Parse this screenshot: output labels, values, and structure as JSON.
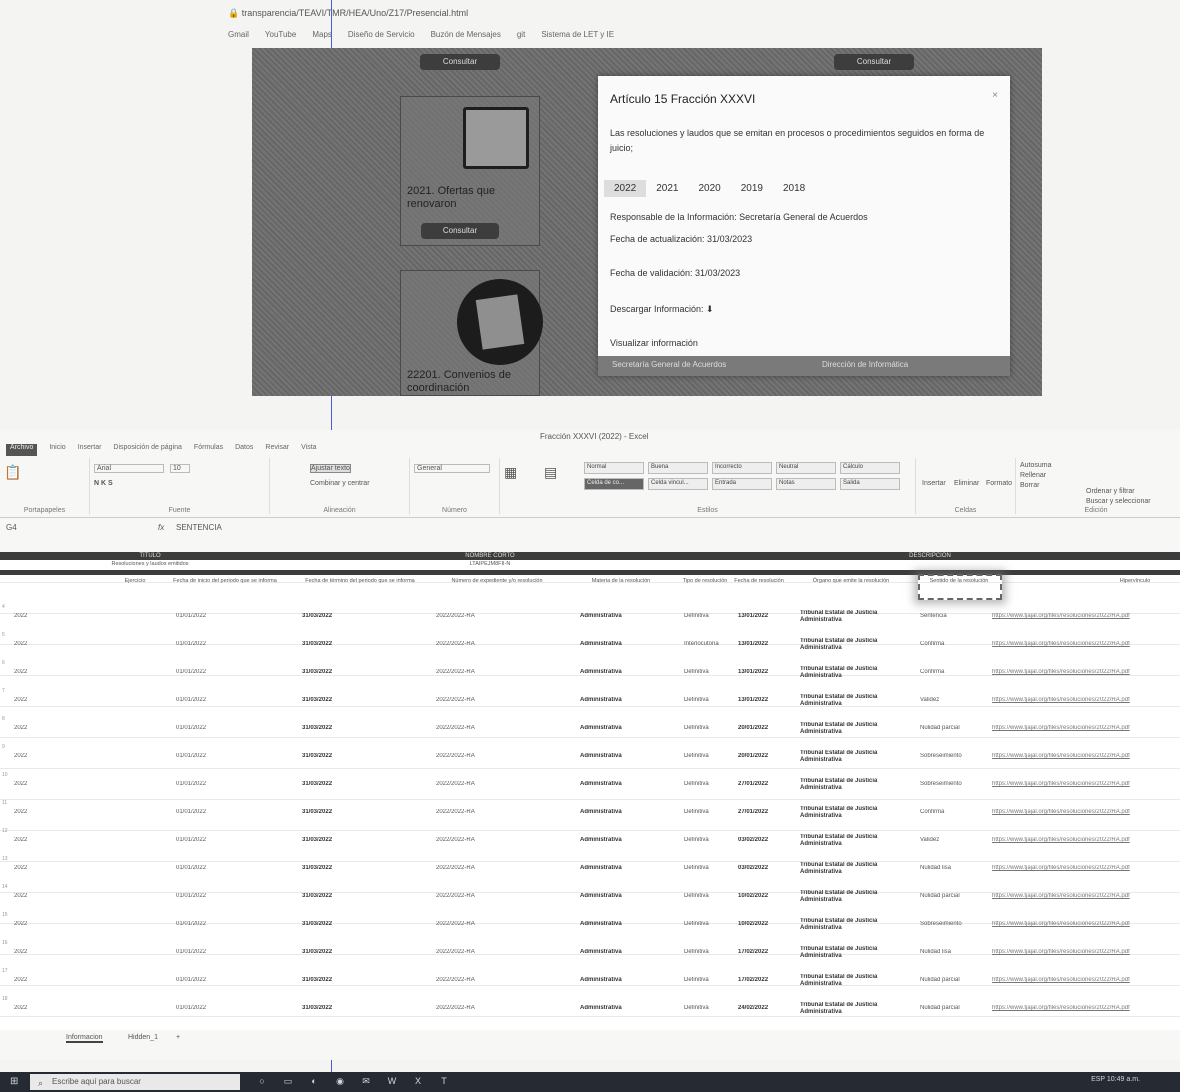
{
  "browser": {
    "url": "transparencia/TEAVI/TMR/HEA/Uno/Z17/Presencial.html",
    "bookmarks": [
      "Gmail",
      "YouTube",
      "Maps",
      "Diseño de Servicio",
      "Buzón de Mensajes",
      "git",
      "Sistema de LET y IE"
    ]
  },
  "web": {
    "tiles": [
      {
        "title": "2021. Ofertas que renovaron",
        "button": "Consultar"
      },
      {
        "title": "22201. Convenios de coordinación",
        "button": ""
      }
    ],
    "top_buttons": [
      "Consultar",
      "Consultar"
    ],
    "modal": {
      "title": "Artículo 15 Fracción XXXVI",
      "close": "×",
      "description": "Las resoluciones y laudos que se emitan en procesos o procedimientos seguidos en forma de juicio;",
      "years": [
        "2022",
        "2021",
        "2020",
        "2019",
        "2018"
      ],
      "responsible": "Responsable de la Información: Secretaría General de Acuerdos",
      "updated": "Fecha de actualización: 31/03/2023",
      "validated": "Fecha de validación: 31/03/2023",
      "download": "Descargar Información: ⬇",
      "view": "Visualizar información",
      "footer_left": "Secretaría General de Acuerdos",
      "footer_right": "Dirección de Informática"
    }
  },
  "excel": {
    "title": "Fracción XXXVI (2022) - Excel",
    "tabs": [
      "Archivo",
      "Inicio",
      "Insertar",
      "Disposición de página",
      "Fórmulas",
      "Datos",
      "Revisar",
      "Vista"
    ],
    "ribbon": {
      "font": "Arial",
      "size": "10",
      "wrap": "Ajustar texto",
      "merge": "Combinar y centrar",
      "number_format": "General",
      "styles": [
        "Normal",
        "Buena",
        "Incorrecto",
        "Neutral",
        "Cálculo",
        "Celda de co...",
        "Celda vincul...",
        "Entrada",
        "Notas",
        "Salida"
      ],
      "cells": [
        "Insertar",
        "Eliminar",
        "Formato"
      ],
      "edit": [
        "Autosuma",
        "Rellenar",
        "Borrar",
        "Ordenar y filtrar",
        "Buscar y seleccionar"
      ],
      "group_labels": [
        "Portapapeles",
        "Fuente",
        "Alineación",
        "Número",
        "Estilos",
        "Celdas",
        "Edición"
      ]
    },
    "name_box": "G4",
    "formula": "SENTENCIA",
    "headers": {
      "band1": "TITULO",
      "band1_sub": "Resoluciones y laudos emitidos",
      "band2": "NOMBRE CORTO",
      "band2_sub": "LTAIPEJM8FII-N",
      "band3": "DESCRIPCIÓN",
      "columns": [
        "Ejercicio",
        "Fecha de inicio del periodo que se informa",
        "Fecha de término del periodo que se informa",
        "Número de expediente y/o resolución",
        "Materia de la resolución",
        "Tipo de resolución",
        "Fecha de resolución",
        "Órgano que emite la resolución",
        "Sentido de la resolución",
        "Hipervínculo"
      ]
    },
    "rows": [
      {
        "a": "2022",
        "b": "01/01/2022",
        "c": "31/03/2022",
        "d": "2022/2022-RA",
        "e": "Administrativa",
        "f": "Definitiva",
        "g": "13/01/2022",
        "h": "Tribunal Estatal de Justicia Administrativa",
        "i": "Sentencia",
        "j": "https://www.tjajal.org/files/resoluciones/2022/RA.pdf"
      },
      {
        "a": "2022",
        "b": "01/01/2022",
        "c": "31/03/2022",
        "d": "2022/2022-RA",
        "e": "Administrativa",
        "f": "Interlocutoria",
        "g": "13/01/2022",
        "h": "Tribunal Estatal de Justicia Administrativa",
        "i": "Confirma",
        "j": "https://www.tjajal.org/files/resoluciones/2022/RA.pdf"
      },
      {
        "a": "2022",
        "b": "01/01/2022",
        "c": "31/03/2022",
        "d": "2022/2022-RA",
        "e": "Administrativa",
        "f": "Definitiva",
        "g": "13/01/2022",
        "h": "Tribunal Estatal de Justicia Administrativa",
        "i": "Confirma",
        "j": "https://www.tjajal.org/files/resoluciones/2022/RA.pdf"
      },
      {
        "a": "2022",
        "b": "01/01/2022",
        "c": "31/03/2022",
        "d": "2022/2022-RA",
        "e": "Administrativa",
        "f": "Definitiva",
        "g": "13/01/2022",
        "h": "Tribunal Estatal de Justicia Administrativa",
        "i": "Validez",
        "j": "https://www.tjajal.org/files/resoluciones/2022/RA.pdf"
      },
      {
        "a": "2022",
        "b": "01/01/2022",
        "c": "31/03/2022",
        "d": "2022/2022-RA",
        "e": "Administrativa",
        "f": "Definitiva",
        "g": "20/01/2022",
        "h": "Tribunal Estatal de Justicia Administrativa",
        "i": "Nulidad parcial",
        "j": "https://www.tjajal.org/files/resoluciones/2022/RA.pdf"
      },
      {
        "a": "2022",
        "b": "01/01/2022",
        "c": "31/03/2022",
        "d": "2022/2022-RA",
        "e": "Administrativa",
        "f": "Definitiva",
        "g": "20/01/2022",
        "h": "Tribunal Estatal de Justicia Administrativa",
        "i": "Sobreseimiento",
        "j": "https://www.tjajal.org/files/resoluciones/2022/RA.pdf"
      },
      {
        "a": "2022",
        "b": "01/01/2022",
        "c": "31/03/2022",
        "d": "2022/2022-RA",
        "e": "Administrativa",
        "f": "Definitiva",
        "g": "27/01/2022",
        "h": "Tribunal Estatal de Justicia Administrativa",
        "i": "Sobreseimiento",
        "j": "https://www.tjajal.org/files/resoluciones/2022/RA.pdf"
      },
      {
        "a": "2022",
        "b": "01/01/2022",
        "c": "31/03/2022",
        "d": "2022/2022-RA",
        "e": "Administrativa",
        "f": "Definitiva",
        "g": "27/01/2022",
        "h": "Tribunal Estatal de Justicia Administrativa",
        "i": "Confirma",
        "j": "https://www.tjajal.org/files/resoluciones/2022/RA.pdf"
      },
      {
        "a": "2022",
        "b": "01/01/2022",
        "c": "31/03/2022",
        "d": "2022/2022-RA",
        "e": "Administrativa",
        "f": "Definitiva",
        "g": "03/02/2022",
        "h": "Tribunal Estatal de Justicia Administrativa",
        "i": "Validez",
        "j": "https://www.tjajal.org/files/resoluciones/2022/RA.pdf"
      },
      {
        "a": "2022",
        "b": "01/01/2022",
        "c": "31/03/2022",
        "d": "2022/2022-RA",
        "e": "Administrativa",
        "f": "Definitiva",
        "g": "03/02/2022",
        "h": "Tribunal Estatal de Justicia Administrativa",
        "i": "Nulidad lisa",
        "j": "https://www.tjajal.org/files/resoluciones/2022/RA.pdf"
      },
      {
        "a": "2022",
        "b": "01/01/2022",
        "c": "31/03/2022",
        "d": "2022/2022-RA",
        "e": "Administrativa",
        "f": "Definitiva",
        "g": "10/02/2022",
        "h": "Tribunal Estatal de Justicia Administrativa",
        "i": "Nulidad parcial",
        "j": "https://www.tjajal.org/files/resoluciones/2022/RA.pdf"
      },
      {
        "a": "2022",
        "b": "01/01/2022",
        "c": "31/03/2022",
        "d": "2022/2022-RA",
        "e": "Administrativa",
        "f": "Definitiva",
        "g": "10/02/2022",
        "h": "Tribunal Estatal de Justicia Administrativa",
        "i": "Sobreseimiento",
        "j": "https://www.tjajal.org/files/resoluciones/2022/RA.pdf"
      },
      {
        "a": "2022",
        "b": "01/01/2022",
        "c": "31/03/2022",
        "d": "2022/2022-RA",
        "e": "Administrativa",
        "f": "Definitiva",
        "g": "17/02/2022",
        "h": "Tribunal Estatal de Justicia Administrativa",
        "i": "Nulidad lisa",
        "j": "https://www.tjajal.org/files/resoluciones/2022/RA.pdf"
      },
      {
        "a": "2022",
        "b": "01/01/2022",
        "c": "31/03/2022",
        "d": "2022/2022-RA",
        "e": "Administrativa",
        "f": "Definitiva",
        "g": "17/02/2022",
        "h": "Tribunal Estatal de Justicia Administrativa",
        "i": "Nulidad parcial",
        "j": "https://www.tjajal.org/files/resoluciones/2022/RA.pdf"
      },
      {
        "a": "2022",
        "b": "01/01/2022",
        "c": "31/03/2022",
        "d": "2022/2022-RA",
        "e": "Administrativa",
        "f": "Definitiva",
        "g": "24/02/2022",
        "h": "Tribunal Estatal de Justicia Administrativa",
        "i": "Nulidad parcial",
        "j": "https://www.tjajal.org/files/resoluciones/2022/RA.pdf"
      }
    ],
    "sheets": [
      "Informacion",
      "Hidden_1"
    ],
    "sheet_add": "+"
  },
  "taskbar": {
    "search_placeholder": "Escribe aquí para buscar",
    "tray": "ESP  10:49 a.m."
  },
  "colors": {
    "taskbar": "#262b33",
    "modal_bg": "#fafafa",
    "overlay": "#6c6c6c",
    "excel_band": "#3c3c3c"
  },
  "icons": [
    "windows-start-icon",
    "search-icon",
    "chart-icon",
    "document-circle-icon",
    "download-icon",
    "close-icon"
  ]
}
